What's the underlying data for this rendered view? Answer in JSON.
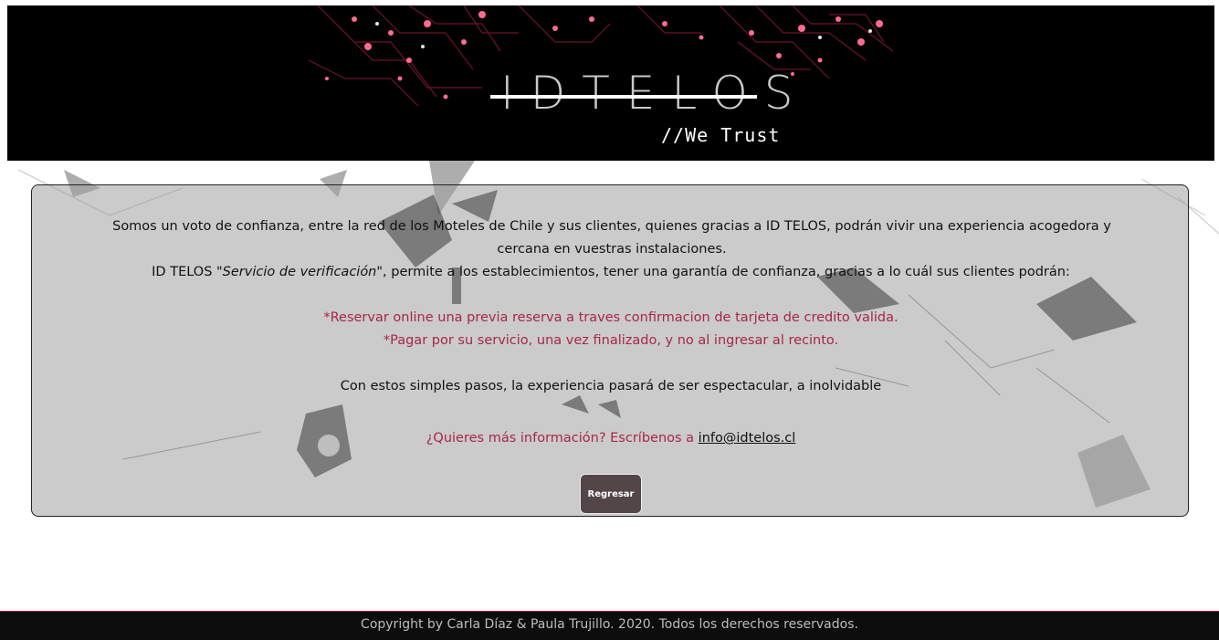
{
  "header": {
    "logo_text": "IDTELOS",
    "tagline": "//We Trust"
  },
  "panel": {
    "intro_line1": "Somos un voto de confianza, entre la red de los Moteles de Chile y sus clientes, quienes gracias a ID TELOS, podrán vivir una experiencia acogedora y cercana en vuestras instalaciones.",
    "intro_brand": "ID TELOS ",
    "intro_service": "\"Servicio de verificación\"",
    "intro_rest": ", permite a los establecimientos, tener una garantía de confianza, gracias a lo cuál sus clientes podrán:",
    "bullet1": "*Reservar online una previa reserva a traves confirmacion de tarjeta de credito valida.",
    "bullet2": "*Pagar por su servicio, una vez finalizado, y no al ingresar al recinto.",
    "simple_steps": "Con estos simples pasos, la experiencia pasará de ser espectacular, a inolvidable",
    "contact_text": "¿Quieres más información? Escríbenos a ",
    "contact_email": "info@idtelos.cl",
    "back_button": "Regresar"
  },
  "footer": {
    "copyright": "Copyright by Carla Díaz & Paula Trujillo. 2020. Todos los derechos reservados."
  },
  "colors": {
    "accent": "#a7264a",
    "header_bg": "#000000",
    "button_bg": "#524649"
  }
}
